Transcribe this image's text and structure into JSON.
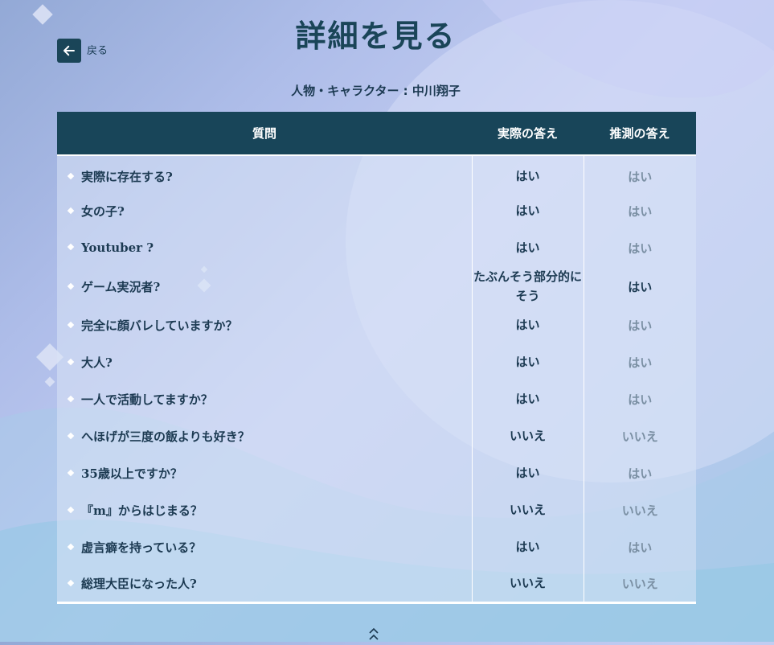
{
  "header": {
    "back_label": "戻る",
    "title": "詳細を見る"
  },
  "subject": {
    "label": "人物・キャラクター : 中川翔子"
  },
  "table": {
    "columns": [
      "質問",
      "実際の答え",
      "推測の答え"
    ],
    "rows": [
      {
        "question": "実際に存在する?",
        "actual": "はい",
        "guess": "はい",
        "match": true
      },
      {
        "question": "女の子?",
        "actual": "はい",
        "guess": "はい",
        "match": true
      },
      {
        "question": "Youtuber ?",
        "actual": "はい",
        "guess": "はい",
        "match": true
      },
      {
        "question": "ゲーム実況者?",
        "actual": "たぶんそう部分的にそう",
        "guess": "はい",
        "match": false
      },
      {
        "question": "完全に顔バレしていますか？",
        "actual": "はい",
        "guess": "はい",
        "match": true
      },
      {
        "question": "大人?",
        "actual": "はい",
        "guess": "はい",
        "match": true
      },
      {
        "question": "一人で活動してますか？",
        "actual": "はい",
        "guess": "はい",
        "match": true
      },
      {
        "question": "へほげが三度の飯よりも好き？",
        "actual": "いいえ",
        "guess": "いいえ",
        "match": true
      },
      {
        "question": "35歳以上ですか？",
        "actual": "はい",
        "guess": "はい",
        "match": true
      },
      {
        "question": "『m』からはじまる？",
        "actual": "いいえ",
        "guess": "いいえ",
        "match": true
      },
      {
        "question": "虚言癖を持っている？",
        "actual": "はい",
        "guess": "はい",
        "match": true
      },
      {
        "question": "総理大臣になった人?",
        "actual": "いいえ",
        "guess": "いいえ",
        "match": true
      }
    ]
  },
  "icons": {
    "back": "arrow-left-icon",
    "scroll_top": "double-chevron-up-icon"
  },
  "colors": {
    "header_bg": "#184559",
    "text_primary": "#1c3a52",
    "text_muted": "#7a8fa3"
  }
}
